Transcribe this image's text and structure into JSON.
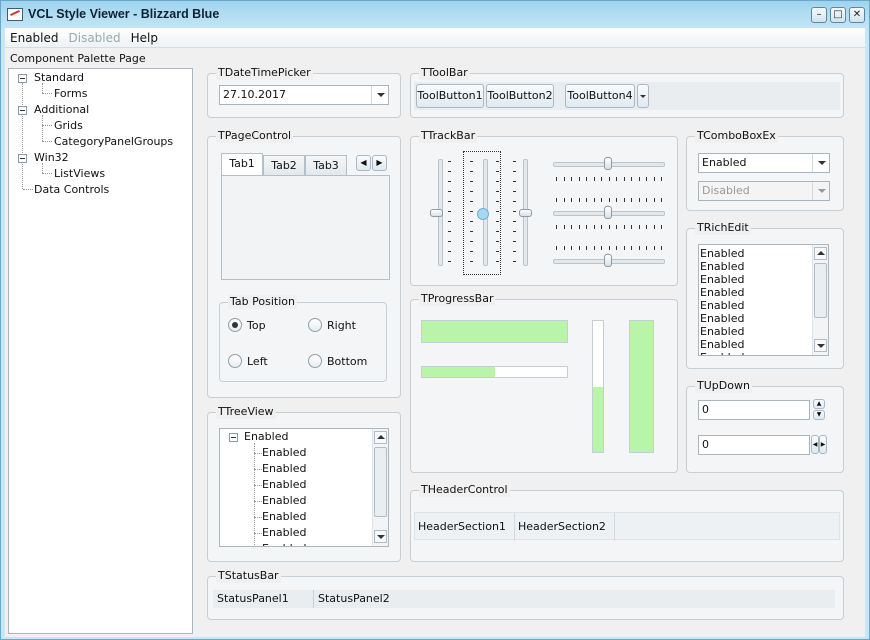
{
  "window": {
    "title": "VCL Style Viewer - Blizzard Blue"
  },
  "menu": {
    "items": [
      "Enabled",
      "Disabled",
      "Help"
    ]
  },
  "palette": {
    "label": "Component Palette Page",
    "tree": [
      {
        "label": "Standard",
        "children": [
          "Forms"
        ]
      },
      {
        "label": "Additional",
        "children": [
          "Grids",
          "CategoryPanelGroups"
        ]
      },
      {
        "label": "Win32",
        "children": [
          "ListViews"
        ]
      },
      {
        "label": "Data Controls",
        "children": []
      }
    ]
  },
  "datetimepicker": {
    "label": "TDateTimePicker",
    "value": "27.10.2017"
  },
  "toolbar": {
    "label": "TToolBar",
    "buttons": [
      "ToolButton1",
      "ToolButton2",
      "ToolButton4"
    ]
  },
  "pagecontrol": {
    "label": "TPageControl",
    "tabs": [
      "Tab1",
      "Tab2",
      "Tab3"
    ],
    "tab_position": {
      "label": "Tab Position",
      "options": [
        "Top",
        "Right",
        "Left",
        "Bottom"
      ],
      "selected": "Top"
    }
  },
  "trackbar": {
    "label": "TTrackBar"
  },
  "comboboxex": {
    "label": "TComboBoxEx",
    "enabled_value": "Enabled",
    "disabled_value": "Disabled"
  },
  "richedit": {
    "label": "TRichEdit",
    "lines": [
      "Enabled",
      "Enabled",
      "Enabled",
      "Enabled",
      "Enabled",
      "Enabled",
      "Enabled",
      "Enabled",
      "Enabled"
    ]
  },
  "progressbar": {
    "label": "TProgressBar",
    "values": [
      100,
      50,
      50,
      100
    ]
  },
  "updown": {
    "label": "TUpDown",
    "values": [
      "0",
      "0"
    ]
  },
  "treeview": {
    "label": "TTreeView",
    "root": "Enabled",
    "children": [
      "Enabled",
      "Enabled",
      "Enabled",
      "Enabled",
      "Enabled",
      "Enabled",
      "Enabled"
    ]
  },
  "headercontrol": {
    "label": "THeaderControl",
    "sections": [
      "HeaderSection1",
      "HeaderSection2"
    ]
  },
  "statusbar": {
    "label": "TStatusBar",
    "panels": [
      "StatusPanel1",
      "StatusPanel2"
    ]
  },
  "colors": {
    "progress_fill": "#b8f5a8",
    "accent": "#9fd4ee"
  }
}
